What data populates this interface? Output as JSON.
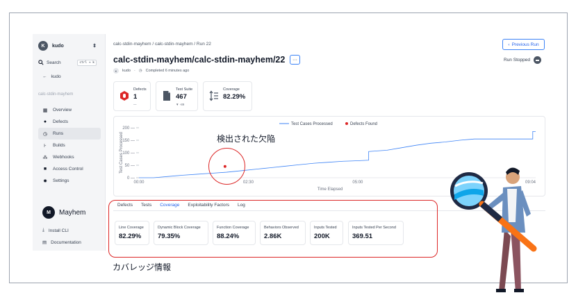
{
  "sidebar": {
    "account": {
      "initial": "K",
      "name": "kudo"
    },
    "search": {
      "label": "Search",
      "shortcut": "ctrl + k"
    },
    "back_label": "kudo",
    "project": "calc-stdin-mayhem",
    "nav": [
      {
        "label": "Overview",
        "icon": "grid-icon"
      },
      {
        "label": "Defects",
        "icon": "bug-icon"
      },
      {
        "label": "Runs",
        "icon": "clock-icon",
        "active": true
      },
      {
        "label": "Builds",
        "icon": "build-icon"
      },
      {
        "label": "Webhooks",
        "icon": "webhook-icon"
      },
      {
        "label": "Access Control",
        "icon": "lock-icon"
      },
      {
        "label": "Settings",
        "icon": "gear-icon"
      }
    ],
    "brand": "Mayhem",
    "install_cli": "Install CLI",
    "documentation": "Documentation"
  },
  "header": {
    "breadcrumb": "calc-stdin-mayhem  /  calc-stdin-mayhem  /  Run 22",
    "title": "calc-stdin-mayhem/calc-stdin-mayhem/22",
    "more": "···",
    "prev_run": "Previous Run",
    "status": "Run Stopped",
    "meta_user_initial": "K",
    "meta_user": "kudo",
    "meta_sep": "·",
    "meta_completed": "Completed 6 minutes ago"
  },
  "stats": {
    "defects": {
      "label": "Defects",
      "value": "1",
      "sub": "—"
    },
    "test_suite": {
      "label": "Test Suite",
      "value": "467",
      "sub": "▼ -89"
    },
    "coverage": {
      "label": "Coverage",
      "value": "82.29%"
    }
  },
  "chart_data": {
    "type": "line",
    "legend": [
      "Test Cases Processed",
      "Defects Found"
    ],
    "legend_position": "top-center",
    "ylabel": "Test Cases Processed",
    "xlabel": "Time Elapsed",
    "yticks": [
      0,
      50,
      100,
      150,
      200
    ],
    "ylim": [
      0,
      200
    ],
    "xticks": [
      "00:00",
      "02:30",
      "05:00",
      "09:04"
    ],
    "xlim_seconds": [
      0,
      544
    ],
    "series": [
      {
        "name": "Test Cases Processed",
        "color": "#3b82f6",
        "x": [
          0,
          20,
          40,
          60,
          80,
          100,
          120,
          140,
          160,
          180,
          200,
          220,
          240,
          260,
          280,
          300,
          315,
          315,
          340,
          360,
          380,
          400,
          420,
          440,
          460,
          480,
          500,
          520,
          540,
          540,
          544
        ],
        "y": [
          0,
          0,
          5,
          10,
          14,
          18,
          22,
          28,
          34,
          40,
          46,
          52,
          58,
          62,
          66,
          68,
          70,
          105,
          110,
          120,
          130,
          138,
          143,
          150,
          155,
          155,
          155,
          155,
          155,
          185,
          185
        ]
      }
    ],
    "defects": [
      {
        "x": 118,
        "y": 45,
        "color": "#dc2626"
      }
    ]
  },
  "tabs": [
    "Defects",
    "Tests",
    "Coverage",
    "Exploitability Factors",
    "Log"
  ],
  "active_tab": "Coverage",
  "coverage": [
    {
      "label": "Line Coverage",
      "value": "82.29%"
    },
    {
      "label": "Dynamic Block Coverage",
      "value": "79.35%"
    },
    {
      "label": "Function Coverage",
      "value": "88.24%"
    },
    {
      "label": "Behaviors Observed",
      "value": "2.86K"
    },
    {
      "label": "Inputs Tested",
      "value": "200K"
    },
    {
      "label": "Inputs Tested Per Second",
      "value": "369.51"
    }
  ],
  "annotations": {
    "defect_found": "検出された欠陥",
    "coverage_info": "カバレッジ情報"
  }
}
